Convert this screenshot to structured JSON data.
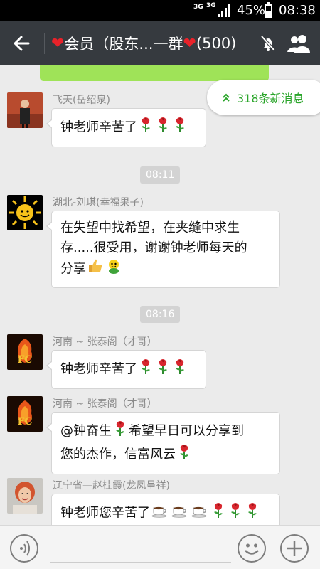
{
  "status_bar": {
    "net1": "3G",
    "net2": "3G",
    "battery_pct": "45%",
    "battery_level": 0.45,
    "time": "08:38"
  },
  "header": {
    "title_prefix": "会员（股东...一群",
    "member_count": "(500)",
    "heart_glyph": "❤",
    "back_icon": "arrow-left-icon",
    "mute_icon": "bell-mute-icon",
    "members_icon": "people-icon"
  },
  "new_messages": {
    "label": "318条新消息",
    "icon": "double-chevron-up-icon",
    "color": "#2aa52a"
  },
  "timestamps": [
    "08:11",
    "08:16"
  ],
  "messages": [
    {
      "sender": "飞天(岳绍泉)",
      "text": "钟老师辛苦了",
      "emojis": [
        "rose",
        "rose",
        "rose"
      ]
    },
    {
      "sender": "湖北-刘琪(幸福果子)",
      "lines": [
        "在失望中找希望，在夹缝中求生",
        "存.....很受用，谢谢钟老师每天的",
        "分享"
      ],
      "emojis": [
        "thumbs-up",
        "smiley-frog"
      ]
    },
    {
      "sender": "河南 ~ 张泰阁（才哥）",
      "text": "钟老师辛苦了",
      "emojis": [
        "rose",
        "rose",
        "rose"
      ]
    },
    {
      "sender": "河南 ~ 张泰阁（才哥）",
      "line1a": "@钟奋生",
      "line1b": "希望早日可以分享到",
      "line2": "您的杰作，信富风云"
    },
    {
      "sender": "辽宁省—赵桂霞(龙凤呈祥)",
      "text": "钟老师您辛苦了",
      "emojis": [
        "coffee",
        "coffee",
        "coffee",
        "rose",
        "rose",
        "rose"
      ]
    }
  ],
  "avatar_text": {
    "fc": "FC"
  },
  "colors": {
    "accent_green": "#9fe358",
    "header_bg": "#363a3f",
    "chat_bg": "#ebebeb"
  }
}
